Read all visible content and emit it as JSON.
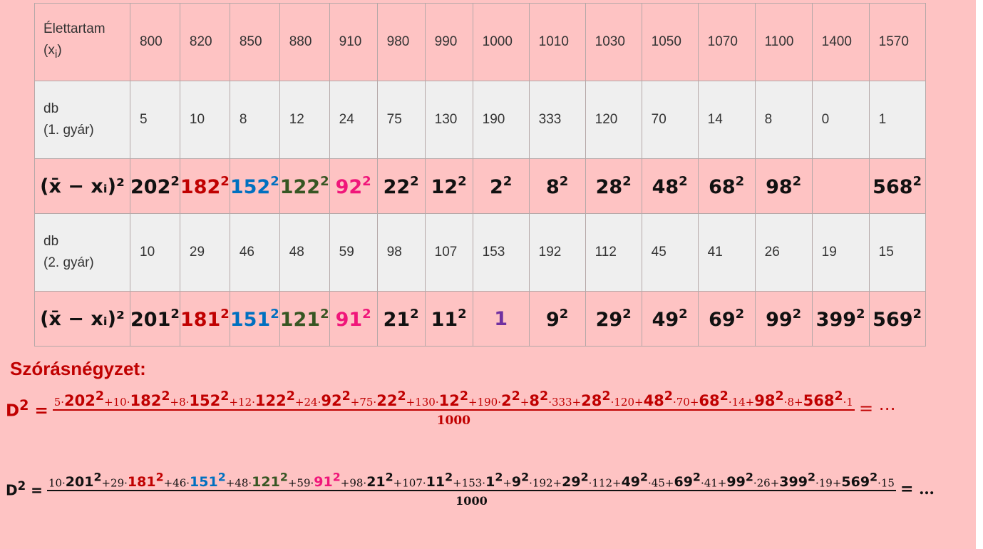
{
  "table": {
    "header_label_line1": "Élettartam",
    "header_label_line2": "(x",
    "header_label_sub": "i",
    "header_label_close": ")",
    "x_values": [
      "800",
      "820",
      "850",
      "880",
      "910",
      "980",
      "990",
      "1000",
      "1010",
      "1030",
      "1050",
      "1070",
      "1100",
      "1400",
      "1570"
    ],
    "db1_label_line1": "db",
    "db1_label_line2": "(1. gyár)",
    "db1_values": [
      "5",
      "10",
      "8",
      "12",
      "24",
      "75",
      "130",
      "190",
      "333",
      "120",
      "70",
      "14",
      "8",
      "0",
      "1"
    ],
    "sq_label": "(x̄ − xᵢ)²",
    "sq1_bases": [
      "202",
      "182",
      "152",
      "122",
      "92",
      "22",
      "12",
      "2",
      "8",
      "28",
      "48",
      "68",
      "98",
      "",
      "568"
    ],
    "db2_label_line1": "db",
    "db2_label_line2": "(2. gyár)",
    "db2_values": [
      "10",
      "29",
      "46",
      "48",
      "59",
      "98",
      "107",
      "153",
      "192",
      "112",
      "45",
      "41",
      "26",
      "19",
      "15"
    ],
    "sq2_bases": [
      "201",
      "181",
      "151",
      "121",
      "91",
      "21",
      "11",
      "1",
      "9",
      "29",
      "49",
      "69",
      "99",
      "399",
      "569"
    ],
    "exponent": "2"
  },
  "section_title": "Szórásnégyzet:",
  "eq1": {
    "lhs": "D",
    "denominator": "1000",
    "rhs": "= ⋯"
  },
  "eq2": {
    "lhs": "D",
    "denominator": "1000",
    "rhs": "= …"
  },
  "colors": {
    "background": "#fec3c3",
    "red": "#c00000",
    "blue": "#0070c0",
    "green": "#375623",
    "pink": "#f0167a",
    "purple": "#7030a0"
  }
}
